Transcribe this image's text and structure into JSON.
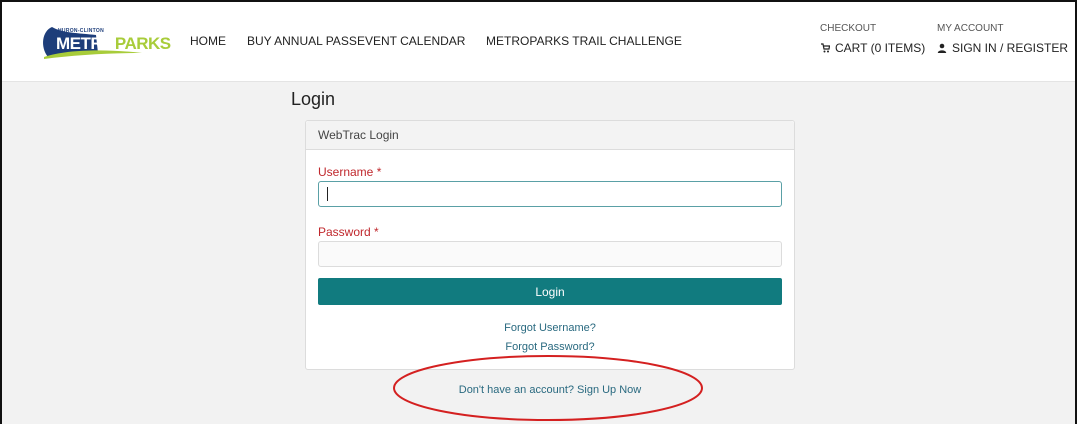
{
  "brand": {
    "small": "HURON-CLINTON",
    "word_metro": "METRO",
    "word_parks": "PARKS",
    "colors": {
      "navy": "#1d3d7a",
      "green": "#a8cc3a",
      "teal": "#117b7f",
      "error": "#c0282d"
    }
  },
  "nav": {
    "items": [
      {
        "label": "HOME"
      },
      {
        "label": "BUY ANNUAL PASS"
      },
      {
        "label": "EVENT CALENDAR"
      },
      {
        "label": "METROPARKS TRAIL CHALLENGE"
      }
    ]
  },
  "account": {
    "checkout_heading": "CHECKOUT",
    "cart_label": "CART (0 ITEMS)",
    "cart_icon": "cart-icon",
    "my_account_heading": "MY ACCOUNT",
    "signin_label": "SIGN IN / REGISTER",
    "user_icon": "user-icon"
  },
  "page": {
    "title": "Login"
  },
  "panel": {
    "heading": "WebTrac Login",
    "username_label": "Username *",
    "username_value": "",
    "password_label": "Password *",
    "password_value": "",
    "login_button": "Login",
    "forgot_username": "Forgot Username?",
    "forgot_password": "Forgot Password?"
  },
  "signup_link": "Don't have an account? Sign Up Now",
  "annotation": {
    "color": "#d42020"
  }
}
